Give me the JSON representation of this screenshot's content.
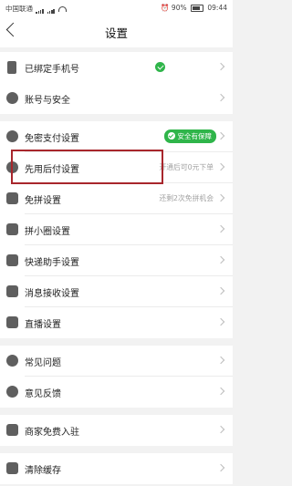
{
  "status_bar": {
    "carrier": "中国联通",
    "battery": "90%",
    "time": "09:44"
  },
  "header": {
    "title": "设置"
  },
  "rows": [
    {
      "label": "已绑定手机号",
      "icon": "phone-icon"
    },
    {
      "label": "账号与安全",
      "icon": "shield-icon"
    },
    {
      "label": "免密支付设置",
      "icon": "key-icon",
      "badge": "安全有保障"
    },
    {
      "label": "先用后付设置",
      "icon": "clock-icon",
      "hint": "开通后可0元下单"
    },
    {
      "label": "免拼设置",
      "icon": "tag-icon",
      "hint": "还剩2次免拼机会"
    },
    {
      "label": "拼小圈设置",
      "icon": "circle-icon"
    },
    {
      "label": "快递助手设置",
      "icon": "box-icon"
    },
    {
      "label": "消息接收设置",
      "icon": "message-icon"
    },
    {
      "label": "直播设置",
      "icon": "video-icon"
    },
    {
      "label": "常见问题",
      "icon": "question-icon"
    },
    {
      "label": "意见反馈",
      "icon": "feedback-icon"
    },
    {
      "label": "商家免费入驻",
      "icon": "store-icon"
    },
    {
      "label": "清除缓存",
      "icon": "trash-icon"
    }
  ],
  "colors": {
    "accent_green": "#2fb54a",
    "highlight_border": "#a8262c",
    "icon_gray": "#5f5f5f"
  }
}
